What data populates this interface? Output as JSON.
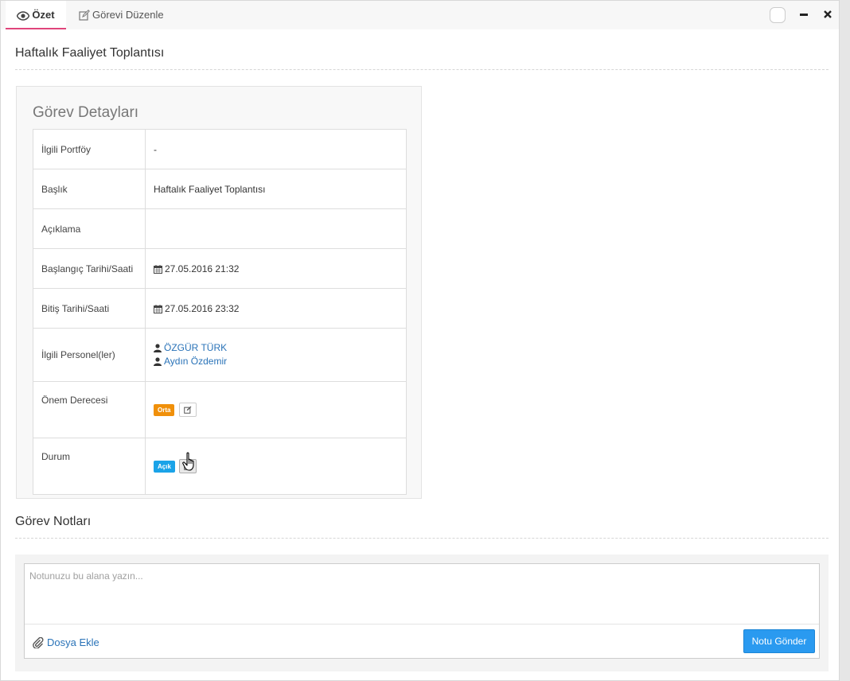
{
  "tabs": [
    {
      "label": "Özet",
      "icon": "eye-icon"
    },
    {
      "label": "Görevi Düzenle",
      "icon": "edit-icon"
    }
  ],
  "page_title": "Haftalık Faaliyet Toplantısı",
  "details": {
    "title": "Görev Detayları",
    "rows": {
      "portfolio": {
        "label": "İlgili Portföy",
        "value": "-"
      },
      "subject": {
        "label": "Başlık",
        "value": "Haftalık Faaliyet Toplantısı"
      },
      "description": {
        "label": "Açıklama",
        "value": ""
      },
      "start": {
        "label": "Başlangıç Tarihi/Saati",
        "value": "27.05.2016 21:32"
      },
      "end": {
        "label": "Bitiş Tarihi/Saati",
        "value": "27.05.2016 23:32"
      },
      "personnel": {
        "label": "İlgili Personel(ler)",
        "people": [
          "ÖZGÜR TÜRK",
          "Aydın Özdemir"
        ]
      },
      "importance": {
        "label": "Önem Derecesi",
        "badge": "Orta",
        "badge_color": "#f0900a"
      },
      "status": {
        "label": "Durum",
        "badge": "Açık",
        "badge_color": "#1aa3e8"
      }
    }
  },
  "notes": {
    "title": "Görev Notları",
    "placeholder": "Notunuzu bu alana yazın...",
    "attach_label": "Dosya Ekle",
    "send_label": "Notu Gönder"
  },
  "colors": {
    "accent": "#e0457b",
    "link": "#2a73b8",
    "primary_button": "#2a9af0"
  }
}
